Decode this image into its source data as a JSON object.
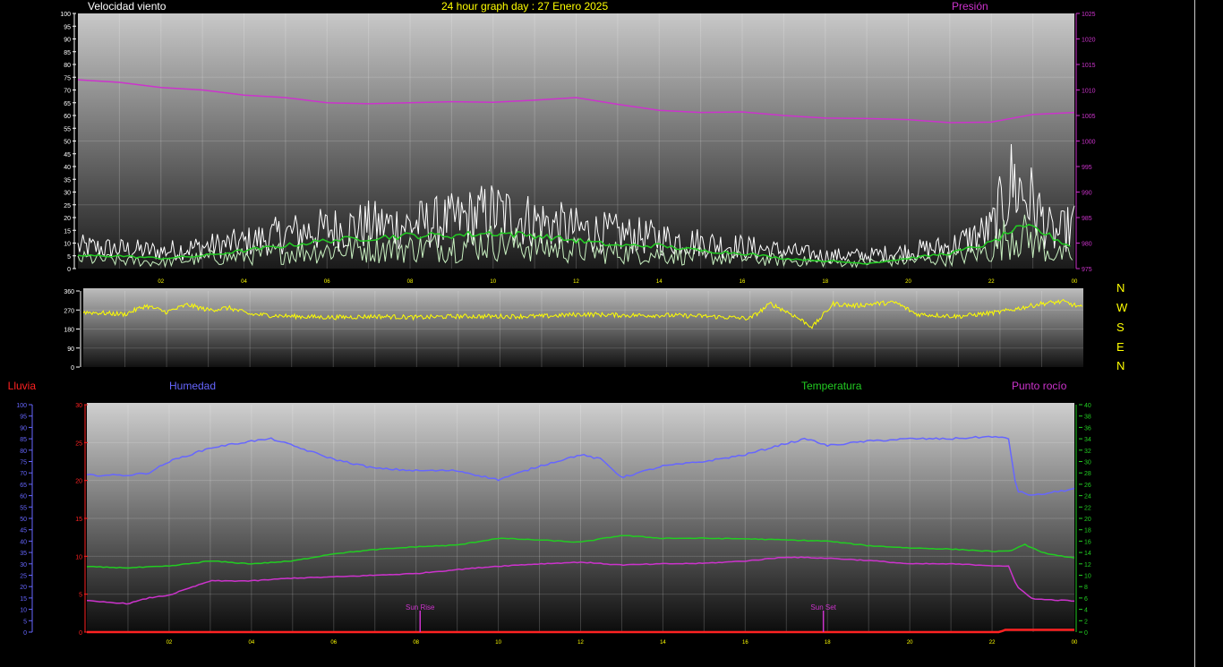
{
  "colors": {
    "wind": "#ffffff",
    "wind_avg": "#c8f0c0",
    "wind_10min": "#22cc22",
    "pressure": "#cc33cc",
    "direction": "#ffff00",
    "humidity": "#6666ff",
    "temperature": "#22cc22",
    "dewpoint": "#cc33cc",
    "rain": "#ff2222",
    "yellow_text": "#ffff00",
    "tick_text": "#ffff00"
  },
  "header": {
    "wind_title": "Velocidad viento",
    "graph_title": "24 hour graph day : 27 Enero 2025",
    "pressure_title": "Presión"
  },
  "compass": [
    "N",
    "W",
    "S",
    "E",
    "N"
  ],
  "bottom_titles": {
    "rain": "Lluvia",
    "humidity": "Humedad",
    "temperature": "Temperatura",
    "dewpoint": "Punto rocío"
  },
  "markers": {
    "sunrise": "Sun Rise",
    "sunset": "Sun Set"
  },
  "chart_data": [
    {
      "type": "line",
      "id": "wind_pressure",
      "x_ticks": [
        "02",
        "04",
        "06",
        "08",
        "10",
        "12",
        "14",
        "16",
        "18",
        "20",
        "22",
        "00"
      ],
      "xlim": [
        0,
        24
      ],
      "y_left_ticks": [
        "0",
        "5",
        "10",
        "15",
        "20",
        "25",
        "30",
        "35",
        "40",
        "45",
        "50",
        "55",
        "60",
        "65",
        "70",
        "75",
        "80",
        "85",
        "90",
        "95",
        "100"
      ],
      "ylim_left": [
        0,
        100
      ],
      "y_right_ticks": [
        "975",
        "980",
        "985",
        "990",
        "995",
        "1000",
        "1005",
        "1010",
        "1015",
        "1020",
        "1025"
      ],
      "ylim_right": [
        975,
        1025
      ],
      "series": [
        {
          "name": "Presión",
          "axis": "right",
          "x": [
            0,
            1,
            2,
            3,
            4,
            5,
            6,
            7,
            8,
            9,
            10,
            11,
            12,
            13,
            14,
            15,
            16,
            17,
            18,
            19,
            20,
            21,
            22,
            23,
            24
          ],
          "y": [
            1012,
            1011.5,
            1010.5,
            1010,
            1009,
            1008.5,
            1007.5,
            1007.3,
            1007.5,
            1007.7,
            1007.6,
            1008,
            1008.5,
            1007.2,
            1006,
            1005.6,
            1005.7,
            1005,
            1004.5,
            1004.4,
            1004.2,
            1003.6,
            1003.7,
            1005.2,
            1005.6
          ]
        },
        {
          "axis": "left",
          "x": [
            0,
            1,
            2,
            3,
            4,
            5,
            6,
            7,
            8,
            9,
            10,
            11,
            12,
            13,
            14,
            15,
            16,
            17,
            18,
            19,
            20,
            21,
            22,
            22.5,
            23,
            23.5,
            24
          ],
          "y": [
            10,
            9,
            8,
            10,
            12,
            16,
            18,
            20,
            20,
            22,
            26,
            22,
            18,
            16,
            14,
            12,
            10,
            8,
            6,
            6,
            8,
            10,
            18,
            40,
            30,
            15,
            20
          ]
        },
        {
          "axis": "left",
          "x": [
            0,
            1,
            2,
            3,
            4,
            5,
            6,
            7,
            8,
            9,
            10,
            11,
            12,
            13,
            14,
            15,
            16,
            17,
            18,
            19,
            20,
            21,
            22,
            22.5,
            23,
            23.5,
            24
          ],
          "y": [
            5,
            4,
            3,
            5,
            6,
            8,
            9,
            10,
            10,
            11,
            13,
            11,
            9,
            8,
            7,
            6,
            5,
            4,
            3,
            3,
            4,
            5,
            9,
            18,
            14,
            7,
            6
          ]
        },
        {
          "axis": "left",
          "x": [
            0,
            1,
            2,
            3,
            4,
            5,
            6,
            7,
            8,
            9,
            10,
            11,
            12,
            13,
            14,
            15,
            16,
            17,
            18,
            19,
            20,
            21,
            22,
            22.5,
            23,
            23.5,
            24
          ],
          "y": [
            5,
            5,
            4,
            5,
            7,
            9,
            11,
            12,
            13,
            13,
            14,
            13,
            11,
            9,
            9,
            7,
            6,
            4,
            3,
            2,
            4,
            6,
            10,
            15,
            16,
            12,
            8
          ]
        }
      ]
    },
    {
      "type": "line",
      "id": "wind_direction",
      "y_ticks": [
        "0",
        "90",
        "180",
        "270",
        "360"
      ],
      "ylim": [
        0,
        360
      ],
      "xlim": [
        0,
        24
      ],
      "series": [
        {
          "axis": "left",
          "x": [
            0,
            1,
            1.5,
            2,
            2.5,
            3,
            3.5,
            4,
            5,
            6,
            7,
            8,
            9,
            10,
            11,
            12,
            13,
            14,
            15,
            16,
            16.5,
            17,
            17.5,
            18,
            18.5,
            19,
            19.5,
            20,
            21,
            22,
            22.5,
            23,
            23.5,
            24
          ],
          "y": [
            260,
            250,
            290,
            260,
            295,
            270,
            280,
            250,
            240,
            235,
            240,
            235,
            240,
            240,
            240,
            250,
            245,
            245,
            240,
            230,
            300,
            250,
            190,
            300,
            290,
            300,
            305,
            250,
            240,
            260,
            280,
            300,
            310,
            280
          ]
        }
      ]
    },
    {
      "type": "line",
      "id": "temp_humidity",
      "x_ticks": [
        "02",
        "04",
        "06",
        "08",
        "10",
        "12",
        "14",
        "16",
        "18",
        "20",
        "22",
        "00"
      ],
      "xlim": [
        0,
        24
      ],
      "y_rain_ticks": [
        "0",
        "5",
        "10",
        "15",
        "20",
        "25",
        "30",
        "35",
        "40",
        "45",
        "50",
        "55",
        "60",
        "65",
        "70",
        "75",
        "80",
        "85",
        "90",
        "95",
        "100"
      ],
      "ylim_rain": [
        0,
        100
      ],
      "y_left_ticks": [
        "0",
        "5",
        "10",
        "15",
        "20",
        "25",
        "30"
      ],
      "ylim_left": [
        0,
        30
      ],
      "y_right_ticks": [
        "0",
        "2",
        "4",
        "6",
        "8",
        "10",
        "12",
        "14",
        "16",
        "18",
        "20",
        "22",
        "24",
        "26",
        "28",
        "30",
        "32",
        "34",
        "36",
        "38",
        "40"
      ],
      "ylim_right": [
        0,
        40
      ],
      "series": [
        {
          "name": "Humedad",
          "axis": "rain",
          "x": [
            0,
            1,
            1.5,
            2,
            3,
            4,
            4.5,
            5,
            6,
            7,
            8,
            9,
            10,
            11,
            12,
            12.5,
            13,
            14,
            15,
            16,
            17,
            17.5,
            18,
            19,
            20,
            21,
            22,
            22.4,
            22.6,
            23,
            24
          ],
          "y": [
            69,
            69,
            70,
            75,
            81,
            84,
            85,
            82,
            76,
            72,
            71,
            71,
            67,
            73,
            78,
            76,
            68,
            73,
            75,
            78,
            83,
            85,
            82,
            84,
            85,
            85,
            86,
            85,
            62,
            60,
            63
          ]
        },
        {
          "name": "Temperatura",
          "axis": "right",
          "x": [
            0,
            1,
            2,
            3,
            4,
            5,
            6,
            7,
            8,
            9,
            10,
            11,
            12,
            13,
            14,
            15,
            16,
            17,
            18,
            19,
            20,
            21,
            22,
            22.4,
            22.8,
            23.2,
            24
          ],
          "y": [
            11.5,
            11.3,
            11.6,
            12.5,
            12,
            12.5,
            13.8,
            14.5,
            15,
            15.3,
            16.5,
            16.2,
            15.8,
            17,
            16.5,
            16.5,
            16.4,
            16.2,
            16,
            15.2,
            14.8,
            14.6,
            14.2,
            14.2,
            15.4,
            14,
            13
          ]
        },
        {
          "name": "Punto rocío",
          "axis": "right",
          "x": [
            0,
            1,
            1.5,
            2,
            3,
            4,
            5,
            6,
            7,
            8,
            9,
            10,
            11,
            12,
            13,
            14,
            15,
            16,
            17,
            18,
            19,
            20,
            21,
            22,
            22.4,
            22.6,
            23,
            24
          ],
          "y": [
            5.5,
            5,
            6,
            6.5,
            9,
            9,
            9.5,
            9.7,
            10,
            10.3,
            11,
            11.6,
            12,
            12.3,
            11.8,
            12,
            12.1,
            12.5,
            13.2,
            13,
            12.6,
            12,
            12,
            11.7,
            11.6,
            8,
            5.8,
            5.5
          ]
        },
        {
          "name": "Lluvia",
          "axis": "rain",
          "x": [
            0,
            22.2,
            22.3,
            24
          ],
          "y": [
            0,
            0,
            1,
            1
          ]
        }
      ],
      "markers": [
        {
          "x": 8.1,
          "label": "Sun Rise"
        },
        {
          "x": 17.9,
          "label": "Sun Set"
        }
      ]
    }
  ]
}
